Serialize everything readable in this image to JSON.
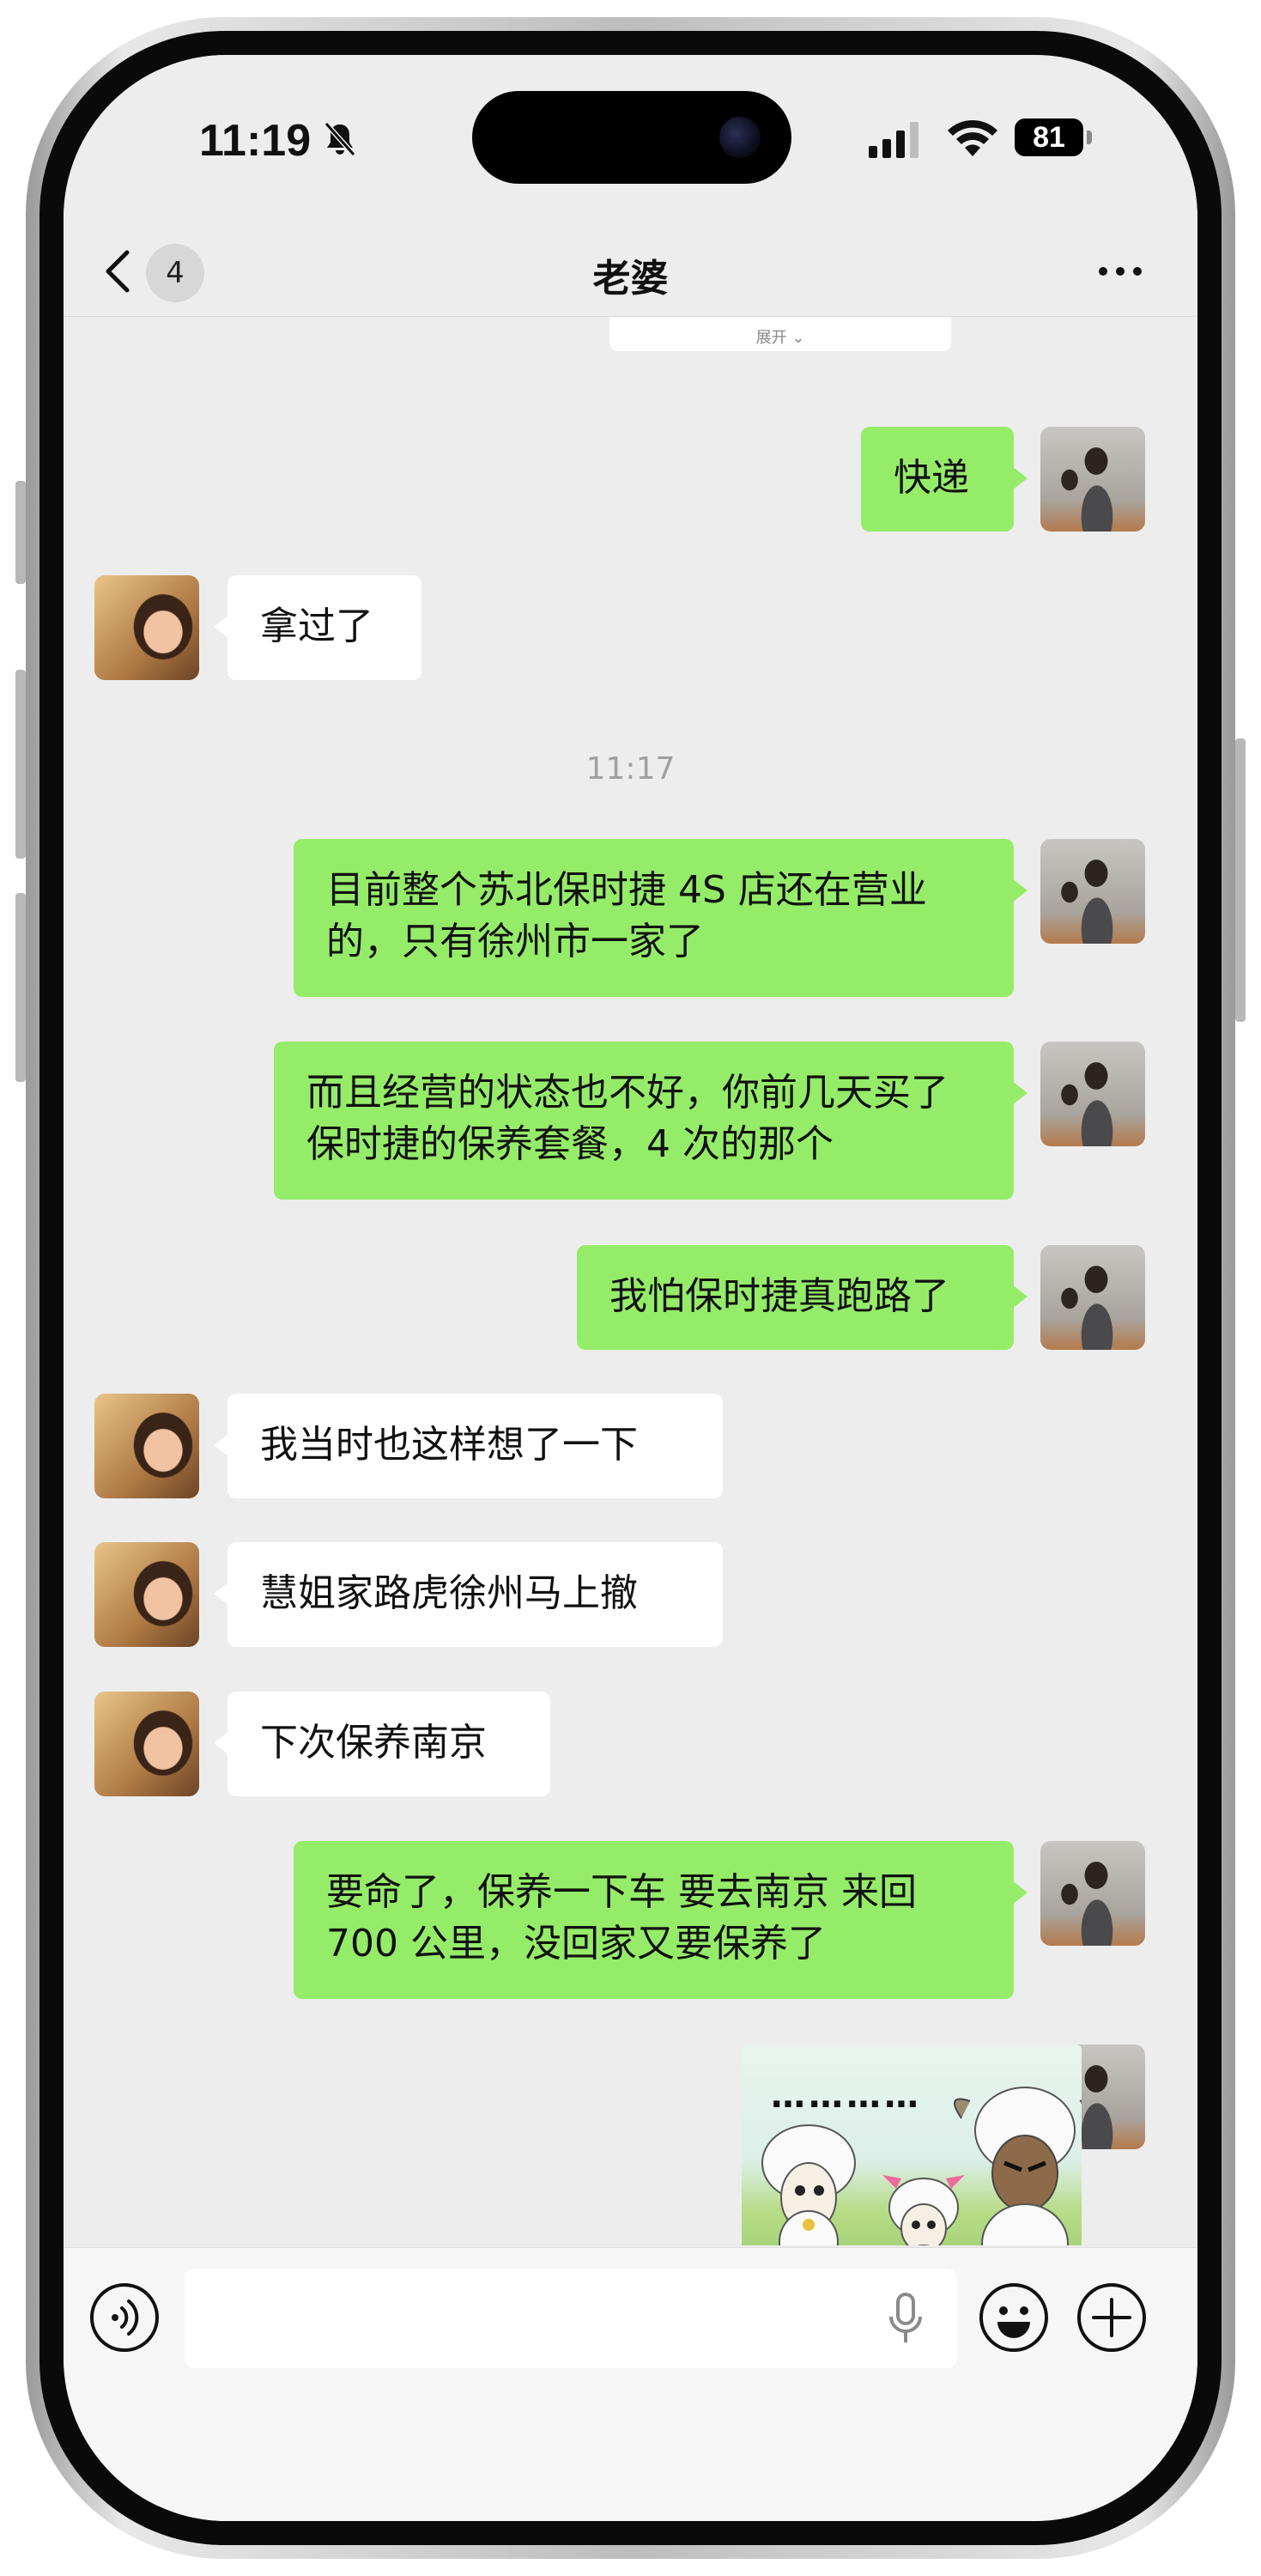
{
  "status_bar": {
    "time": "11:19",
    "battery": "81"
  },
  "nav": {
    "unread_count": "4",
    "title": "老婆"
  },
  "collapsed_card": {
    "expand_label": "展开 ⌄"
  },
  "messages": [
    {
      "from": "me",
      "text": "快递"
    },
    {
      "from": "them",
      "text": "拿过了"
    },
    {
      "from": "timestamp",
      "text": "11:17"
    },
    {
      "from": "me",
      "text": "目前整个苏北保时捷 4S 店还在营业的，只有徐州市一家了"
    },
    {
      "from": "me",
      "text": "而且经营的状态也不好，你前几天买了保时捷的保养套餐，4 次的那个"
    },
    {
      "from": "me",
      "text": "我怕保时捷真跑路了"
    },
    {
      "from": "them",
      "text": "我当时也这样想了一下"
    },
    {
      "from": "them",
      "text": "慧姐家路虎徐州马上撤"
    },
    {
      "from": "them",
      "text": "下次保养南京"
    },
    {
      "from": "me",
      "text": "要命了，保养一下车 要去南京 来回 700 公里，没回家又要保养了"
    },
    {
      "from": "me",
      "type": "sticker",
      "text": "…………"
    }
  ],
  "icons": {
    "back": "chevron-left-icon",
    "more": "more-dots-icon",
    "voice": "voice-icon",
    "mic": "microphone-icon",
    "emoji": "emoji-icon",
    "plus": "plus-icon"
  },
  "colors": {
    "my_bubble": "#95ec69",
    "their_bubble": "#ffffff",
    "background": "#ededed"
  }
}
